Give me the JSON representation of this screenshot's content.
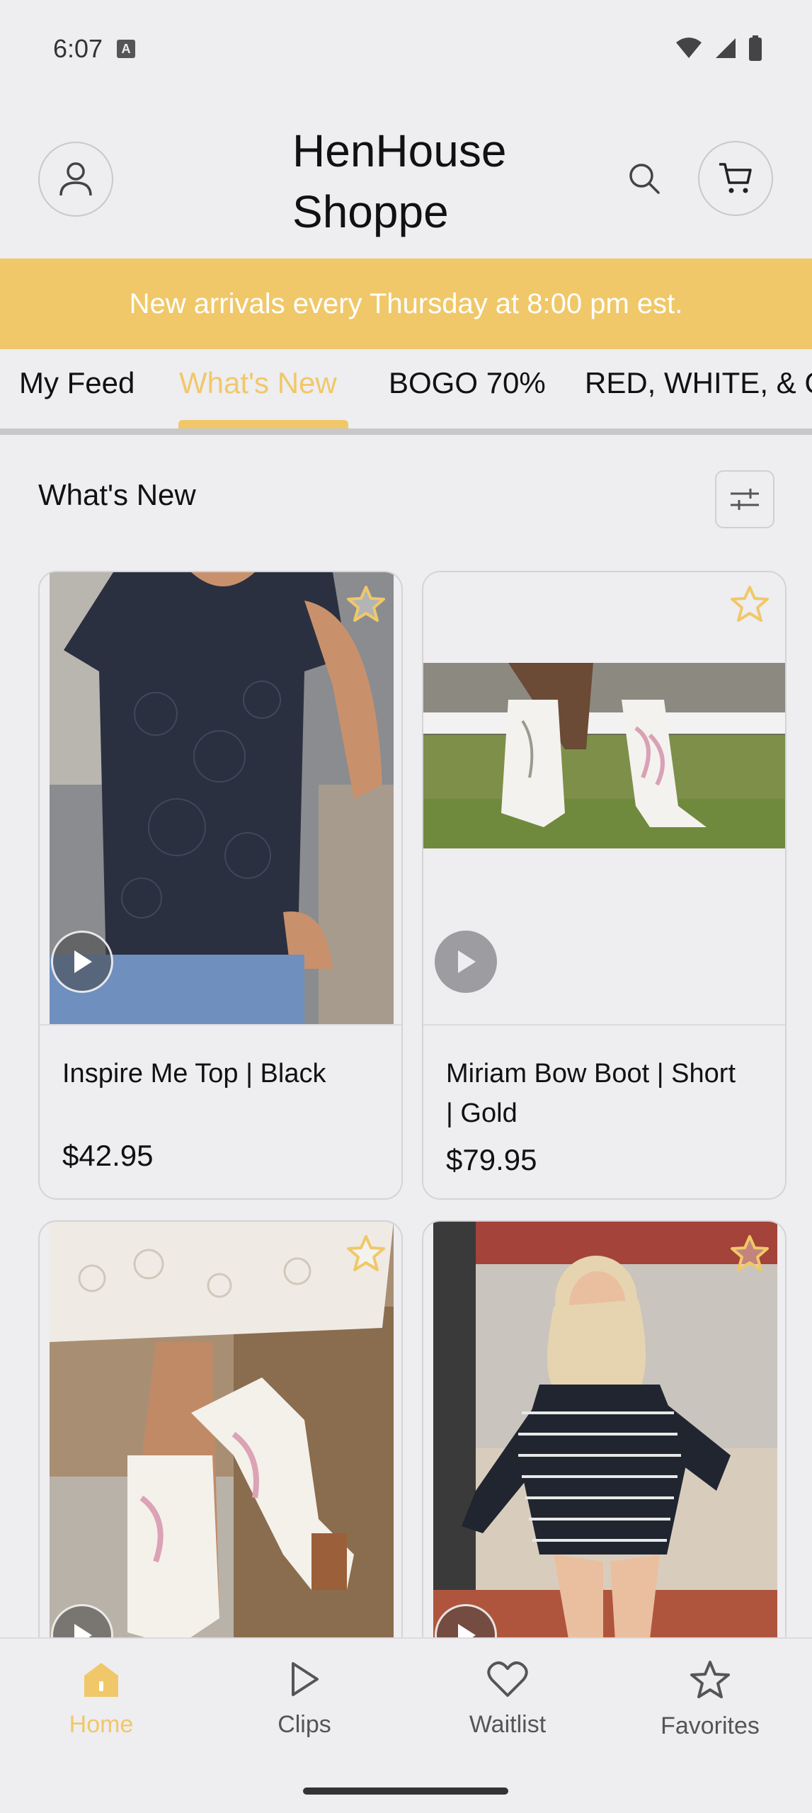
{
  "status_bar": {
    "time": "6:07",
    "badge": "A"
  },
  "header": {
    "brand_line1": "HenHouse",
    "brand_line2": "Shoppe"
  },
  "banner": {
    "text": "New arrivals every Thursday at 8:00 pm est."
  },
  "tabs": [
    {
      "label": "My Feed"
    },
    {
      "label": "What's New"
    },
    {
      "label": "BOGO 70%"
    },
    {
      "label": "RED, WHITE, & C"
    }
  ],
  "section": {
    "title": "What's New"
  },
  "products": [
    {
      "name": "Inspire Me Top | Black",
      "price": "$42.95"
    },
    {
      "name": "Miriam Bow Boot | Short | Gold",
      "price": "$79.95"
    }
  ],
  "bottom_nav": [
    {
      "label": "Home",
      "icon": "home-icon"
    },
    {
      "label": "Clips",
      "icon": "play-outline-icon"
    },
    {
      "label": "Waitlist",
      "icon": "heart-icon"
    },
    {
      "label": "Favorites",
      "icon": "star-icon"
    }
  ],
  "colors": {
    "accent": "#f0c869",
    "background": "#eeedf0"
  }
}
